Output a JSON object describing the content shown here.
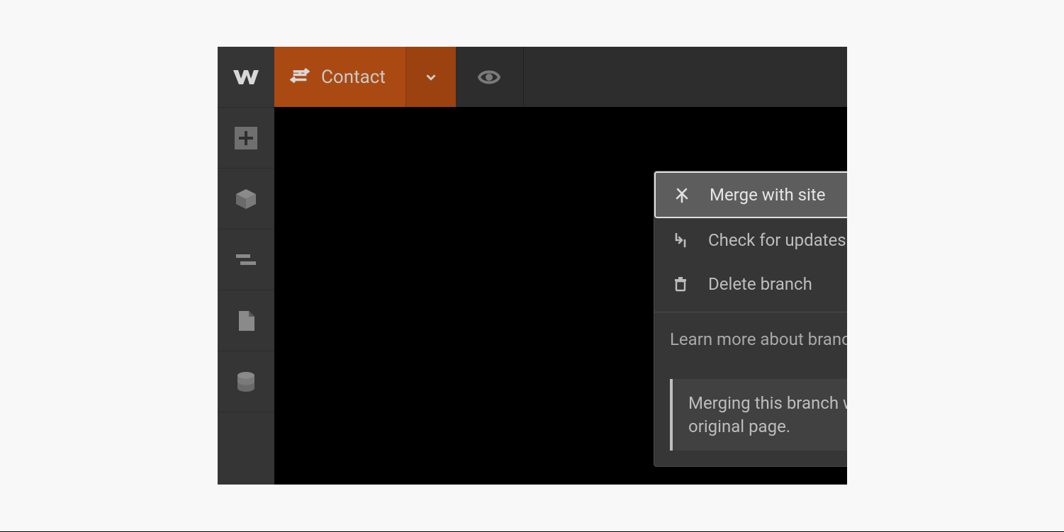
{
  "topbar": {
    "branch_name": "Contact"
  },
  "menu": {
    "merge": "Merge with site",
    "check": "Check for updates",
    "delete": "Delete branch",
    "learn": "Learn more about branching",
    "note": "Merging this branch will replace the original page."
  }
}
